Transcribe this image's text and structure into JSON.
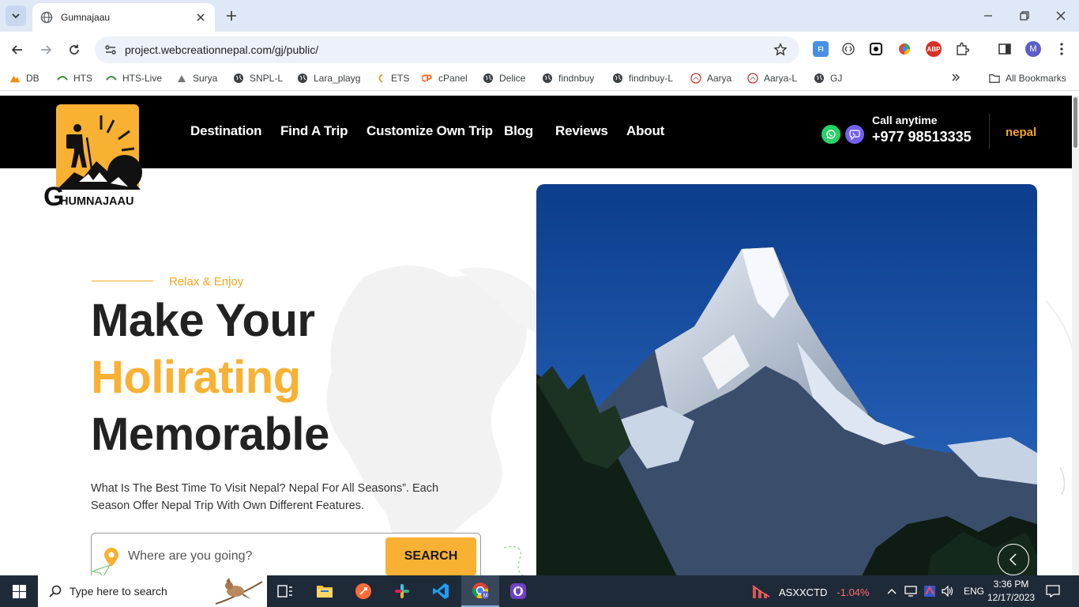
{
  "browser": {
    "tab_title": "Gumnajaau",
    "url": "project.webcreationnepal.com/gj/public/",
    "profile_initial": "M",
    "bookmarks": [
      {
        "label": "DB",
        "icon": "pma-icon"
      },
      {
        "label": "HTS",
        "icon": "hts-icon"
      },
      {
        "label": "HTS-Live",
        "icon": "hts-icon"
      },
      {
        "label": "Surya",
        "icon": "surya-icon"
      },
      {
        "label": "SNPL-L",
        "icon": "globe-icon"
      },
      {
        "label": "Lara_playg",
        "icon": "globe-icon"
      },
      {
        "label": "ETS",
        "icon": "ets-icon"
      },
      {
        "label": "cPanel",
        "icon": "cpanel-icon"
      },
      {
        "label": "Delice",
        "icon": "globe-icon"
      },
      {
        "label": "findnbuy",
        "icon": "globe-icon"
      },
      {
        "label": "findnbuy-L",
        "icon": "globe-icon"
      },
      {
        "label": "Aarya",
        "icon": "aarya-icon"
      },
      {
        "label": "Aarya-L",
        "icon": "aarya-icon"
      },
      {
        "label": "GJ",
        "icon": "globe-icon"
      }
    ],
    "all_bookmarks": "All Bookmarks"
  },
  "site": {
    "logo_text": "HUMNAJAAU",
    "logo_initial": "G",
    "nav": [
      "Destination",
      "Find A Trip",
      "Customize Own Trip",
      "Blog",
      "Reviews",
      "About"
    ],
    "call_label": "Call anytime",
    "phone": "+977 98513335",
    "nepal_logo": "nepal",
    "hero": {
      "eyebrow": "Relax & Enjoy",
      "line1": "Make Your",
      "line2": "Holirating",
      "line3": "Memorable",
      "description": "What Is The Best Time To Visit Nepal? Nepal For All Seasons”. Each Season Offer Nepal Trip With Own Different Features.",
      "search_placeholder": "Where are you going?",
      "search_button": "SEARCH"
    },
    "colors": {
      "accent": "#f8b133",
      "header_bg": "#000000",
      "whatsapp": "#25d366",
      "viber": "#7360f2"
    }
  },
  "taskbar": {
    "search_text": "Type here to search",
    "stock_symbol": "ASXXCTD",
    "stock_change": "-1.04%",
    "language": "ENG",
    "time": "3:36 PM",
    "date": "12/17/2023"
  }
}
